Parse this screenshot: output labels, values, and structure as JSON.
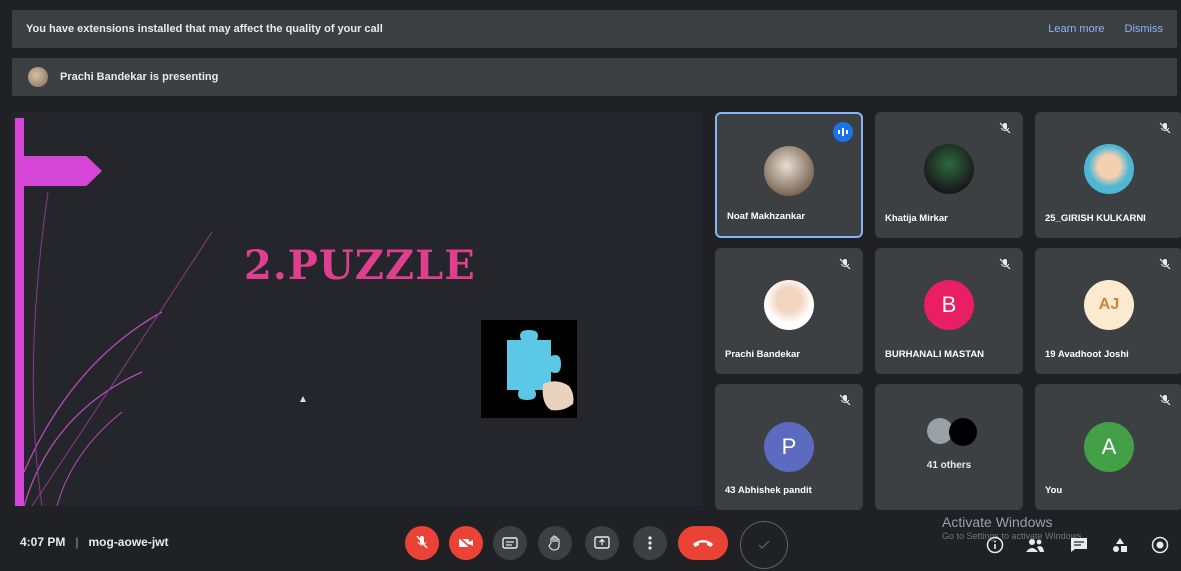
{
  "banner": {
    "text": "You have extensions installed that may affect the quality of your call",
    "learn_more": "Learn more",
    "dismiss": "Dismiss"
  },
  "presenting": {
    "text": "Prachi Bandekar is presenting"
  },
  "slide": {
    "title": "2.PUZZLE"
  },
  "tiles": [
    {
      "name": "Noaf Makhzankar",
      "avatar_type": "photo",
      "speaking": true
    },
    {
      "name": "Khatija Mirkar",
      "avatar_type": "photo"
    },
    {
      "name": "25_GIRISH KULKARNI",
      "avatar_type": "photo"
    },
    {
      "name": "Prachi Bandekar",
      "avatar_type": "photo"
    },
    {
      "name": "BURHANALI MASTAN",
      "avatar_type": "letter",
      "letter": "B",
      "color": "#e91e63"
    },
    {
      "name": "19 Avadhoot Joshi",
      "avatar_type": "letter",
      "letter": "AJ",
      "color": "#fbe9d0"
    },
    {
      "name": "43 Abhishek pandit",
      "avatar_type": "letter",
      "letter": "P",
      "color": "#5c6bc0"
    },
    {
      "name": "",
      "others": "41 others"
    },
    {
      "name": "You",
      "avatar_type": "letter",
      "letter": "A",
      "color": "#43a047"
    }
  ],
  "bottom": {
    "time": "4:07 PM",
    "meeting_code": "mog-aowe-jwt",
    "activate_title": "Activate Windows",
    "activate_sub": "Go to Settings to activate Windows."
  },
  "colors": {
    "accent": "#8ab4f8",
    "danger": "#ea4335",
    "slide_pink": "#e03f8f",
    "slide_magenta": "#d646d6"
  }
}
